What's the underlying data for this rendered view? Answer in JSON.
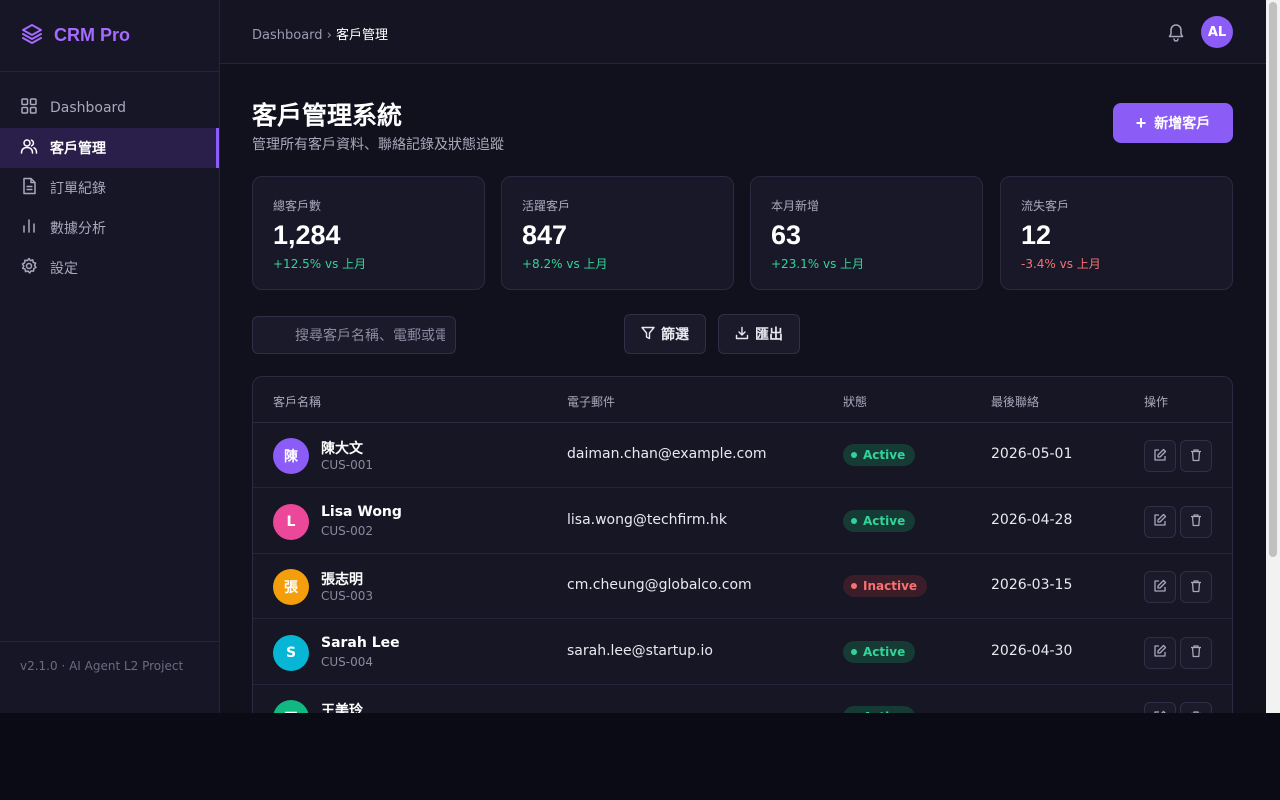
{
  "app": {
    "name": "CRM Pro",
    "version": "v2.1.0 · AI Agent L2 Project"
  },
  "sidebar": {
    "items": [
      {
        "label": "Dashboard",
        "icon": "grid-icon"
      },
      {
        "label": "客戶管理",
        "icon": "users-icon",
        "active": true
      },
      {
        "label": "訂單紀錄",
        "icon": "file-icon"
      },
      {
        "label": "數據分析",
        "icon": "bar-chart-icon"
      },
      {
        "label": "設定",
        "icon": "gear-icon"
      }
    ]
  },
  "topbar": {
    "breadcrumb_root": "Dashboard",
    "breadcrumb_sep": "›",
    "breadcrumb_current": "客戶管理",
    "avatar_initials": "AL"
  },
  "page": {
    "title": "客戶管理系統",
    "subtitle": "管理所有客戶資料、聯絡記錄及狀態追蹤",
    "add_button": "新增客戶"
  },
  "stats": [
    {
      "label": "總客戶數",
      "value": "1,284",
      "change": "+12.5% vs 上月",
      "trend": "up"
    },
    {
      "label": "活躍客戶",
      "value": "847",
      "change": "+8.2% vs 上月",
      "trend": "up"
    },
    {
      "label": "本月新增",
      "value": "63",
      "change": "+23.1% vs 上月",
      "trend": "up"
    },
    {
      "label": "流失客戶",
      "value": "12",
      "change": "-3.4% vs 上月",
      "trend": "down"
    }
  ],
  "toolbar": {
    "search_placeholder": "搜尋客戶名稱、電郵或電話",
    "filter_label": "篩選",
    "export_label": "匯出"
  },
  "table": {
    "headers": {
      "name": "客戶名稱",
      "email": "電子郵件",
      "status": "狀態",
      "last_contact": "最後聯絡",
      "actions": "操作"
    },
    "rows": [
      {
        "initial": "陳",
        "name": "陳大文",
        "id": "CUS-001",
        "email": "daiman.chan@example.com",
        "status": "Active",
        "date": "2026-05-01",
        "avatar_color": "#8b5cf6"
      },
      {
        "initial": "L",
        "name": "Lisa Wong",
        "id": "CUS-002",
        "email": "lisa.wong@techfirm.hk",
        "status": "Active",
        "date": "2026-04-28",
        "avatar_color": "#ec4899"
      },
      {
        "initial": "張",
        "name": "張志明",
        "id": "CUS-003",
        "email": "cm.cheung@globalco.com",
        "status": "Inactive",
        "date": "2026-03-15",
        "avatar_color": "#f59e0b"
      },
      {
        "initial": "S",
        "name": "Sarah Lee",
        "id": "CUS-004",
        "email": "sarah.lee@startup.io",
        "status": "Active",
        "date": "2026-04-30",
        "avatar_color": "#06b6d4"
      },
      {
        "initial": "王",
        "name": "王美玲",
        "id": "",
        "email": "",
        "status": "Active",
        "date": "",
        "avatar_color": "#10b981"
      }
    ]
  },
  "colors": {
    "accent": "#8b5cf6",
    "active": "#34d399",
    "inactive": "#f87171",
    "background": "#11111d"
  }
}
